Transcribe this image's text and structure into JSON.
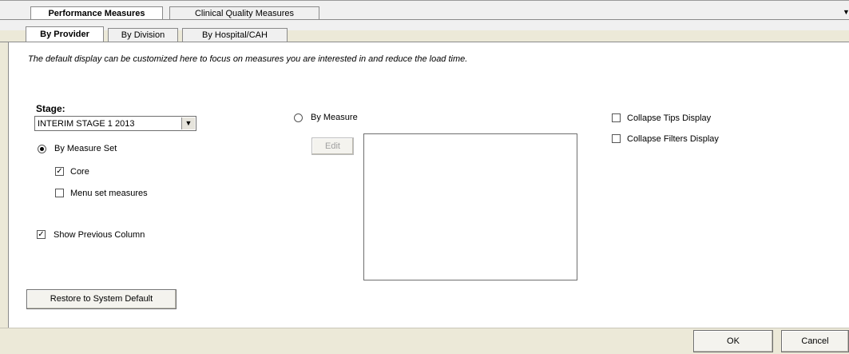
{
  "outer_tabs": [
    {
      "label": "Performance Measures",
      "active": true
    },
    {
      "label": "Clinical Quality Measures",
      "active": false
    }
  ],
  "inner_tabs": [
    {
      "label": "By Provider",
      "active": true
    },
    {
      "label": "By Division",
      "active": false
    },
    {
      "label": "By Hospital/CAH",
      "active": false
    }
  ],
  "info_text": "The default display can be customized here to focus on measures you are interested in and reduce the load time.",
  "stage": {
    "label": "Stage:",
    "value": "INTERIM STAGE 1 2013"
  },
  "by_measure_set": {
    "label": "By Measure Set",
    "selected": true
  },
  "core": {
    "label": "Core",
    "checked": true
  },
  "menu_set": {
    "label": "Menu set measures",
    "checked": false
  },
  "show_previous": {
    "label": "Show Previous Column",
    "checked": true
  },
  "by_measure": {
    "label": "By Measure",
    "selected": false
  },
  "edit_button": "Edit",
  "collapse_tips": {
    "label": "Collapse Tips Display",
    "checked": false
  },
  "collapse_filters": {
    "label": "Collapse Filters Display",
    "checked": false
  },
  "restore_button": "Restore to System Default",
  "ok_button": "OK",
  "cancel_button": "Cancel"
}
